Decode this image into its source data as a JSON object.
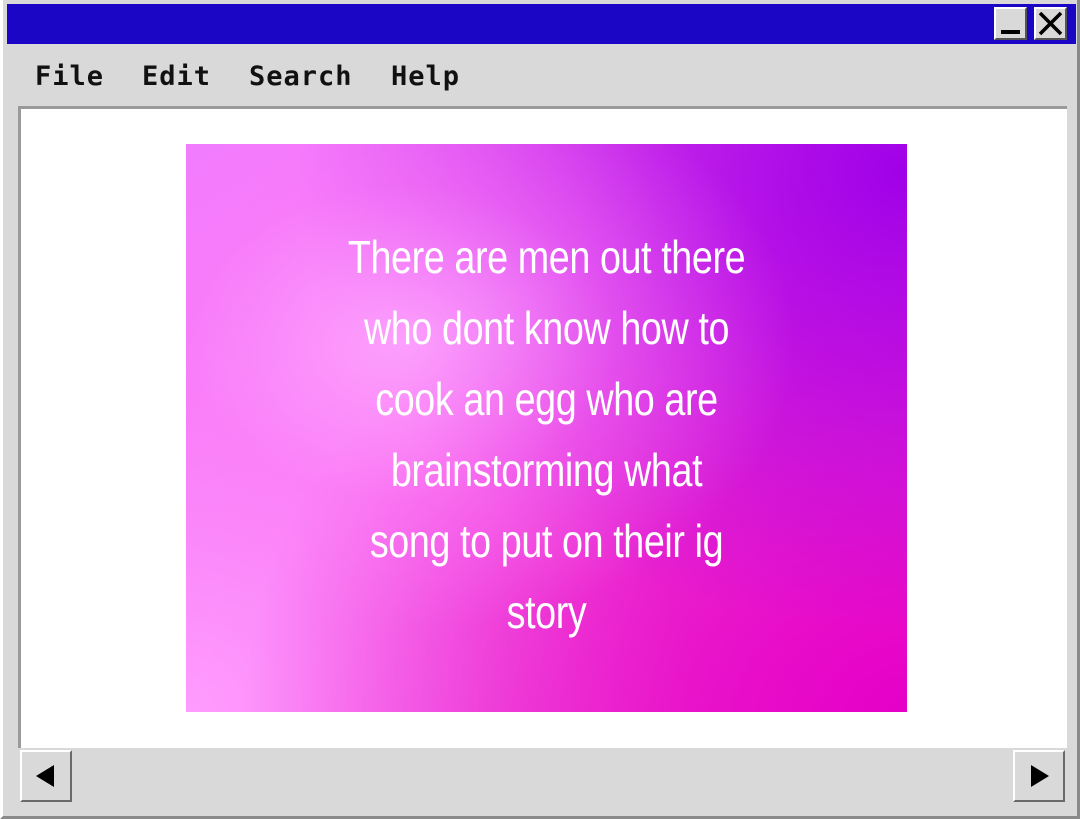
{
  "window": {
    "title_bar_color": "#1a06c4",
    "controls": {
      "minimize_icon": "minimize-icon",
      "close_icon": "close-icon"
    }
  },
  "menu": {
    "items": [
      {
        "label": "File"
      },
      {
        "label": "Edit"
      },
      {
        "label": "Search"
      },
      {
        "label": "Help"
      }
    ]
  },
  "post": {
    "lines": [
      "There are men out there",
      "who dont know how to",
      "cook an egg who are",
      "brainstorming what",
      "song to put on their ig",
      "story"
    ],
    "gradient_colors": [
      "#f07cff",
      "#a000e8",
      "#e600c8"
    ]
  },
  "scrollbar": {
    "left_icon": "arrow-left-icon",
    "right_icon": "arrow-right-icon"
  }
}
